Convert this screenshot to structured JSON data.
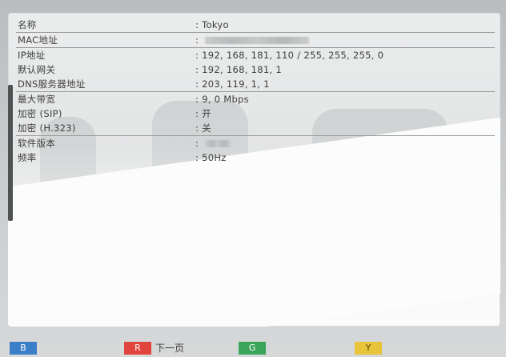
{
  "info": {
    "rows": [
      {
        "label": "名称",
        "value": ": Tokyo",
        "blur": false
      },
      {
        "label": "MAC地址",
        "value": ":",
        "blur": true
      },
      {
        "label": "IP地址",
        "value": ": 192, 168, 181, 110 / 255, 255, 255, 0",
        "blur": false
      },
      {
        "label": "默认网关",
        "value": ": 192, 168, 181, 1",
        "blur": false
      },
      {
        "label": "DNS服务器地址",
        "value": ": 203, 119, 1, 1",
        "blur": false
      },
      {
        "label": "最大带宽",
        "value": ": 9, 0 Mbps",
        "blur": false
      },
      {
        "label": "加密 (SIP)",
        "value": ": 开",
        "blur": false
      },
      {
        "label": "加密 (H.323)",
        "value": ": 关",
        "blur": false
      },
      {
        "label": "软件版本",
        "value": ":",
        "blur": true
      },
      {
        "label": "频率",
        "value": ": 50Hz",
        "blur": false
      }
    ]
  },
  "keys": {
    "b": {
      "letter": "B",
      "color": "#3a7fc8",
      "label": ""
    },
    "r": {
      "letter": "R",
      "color": "#e0443c",
      "label": "下一页"
    },
    "g": {
      "letter": "G",
      "color": "#3aa55a",
      "label": ""
    },
    "y": {
      "letter": "Y",
      "color": "#e8c43a",
      "label": ""
    }
  }
}
